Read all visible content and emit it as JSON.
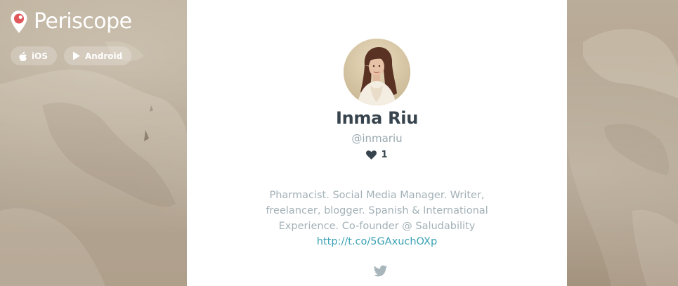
{
  "brand": {
    "name": "Periscope",
    "accent_color": "#e0585c",
    "icon": "periscope-pin-icon"
  },
  "store_buttons": [
    {
      "label": "iOS",
      "icon": "apple-icon"
    },
    {
      "label": "Android",
      "icon": "play-store-icon"
    }
  ],
  "profile": {
    "display_name": "Inma Riu",
    "handle": "@inmariu",
    "hearts_count": "1",
    "hearts_icon": "heart-icon",
    "bio_text": "Pharmacist. Social Media Manager. Writer, freelancer, blogger. Spanish & International Experience. Co-founder @ Saludability",
    "bio_link": "http://t.co/5GAxuchOXp",
    "social_icon": "twitter-icon"
  },
  "colors": {
    "name_text": "#37444d",
    "muted_text": "#a3b1b7",
    "link": "#3aa1b4",
    "panel_bg": "#ffffff"
  }
}
